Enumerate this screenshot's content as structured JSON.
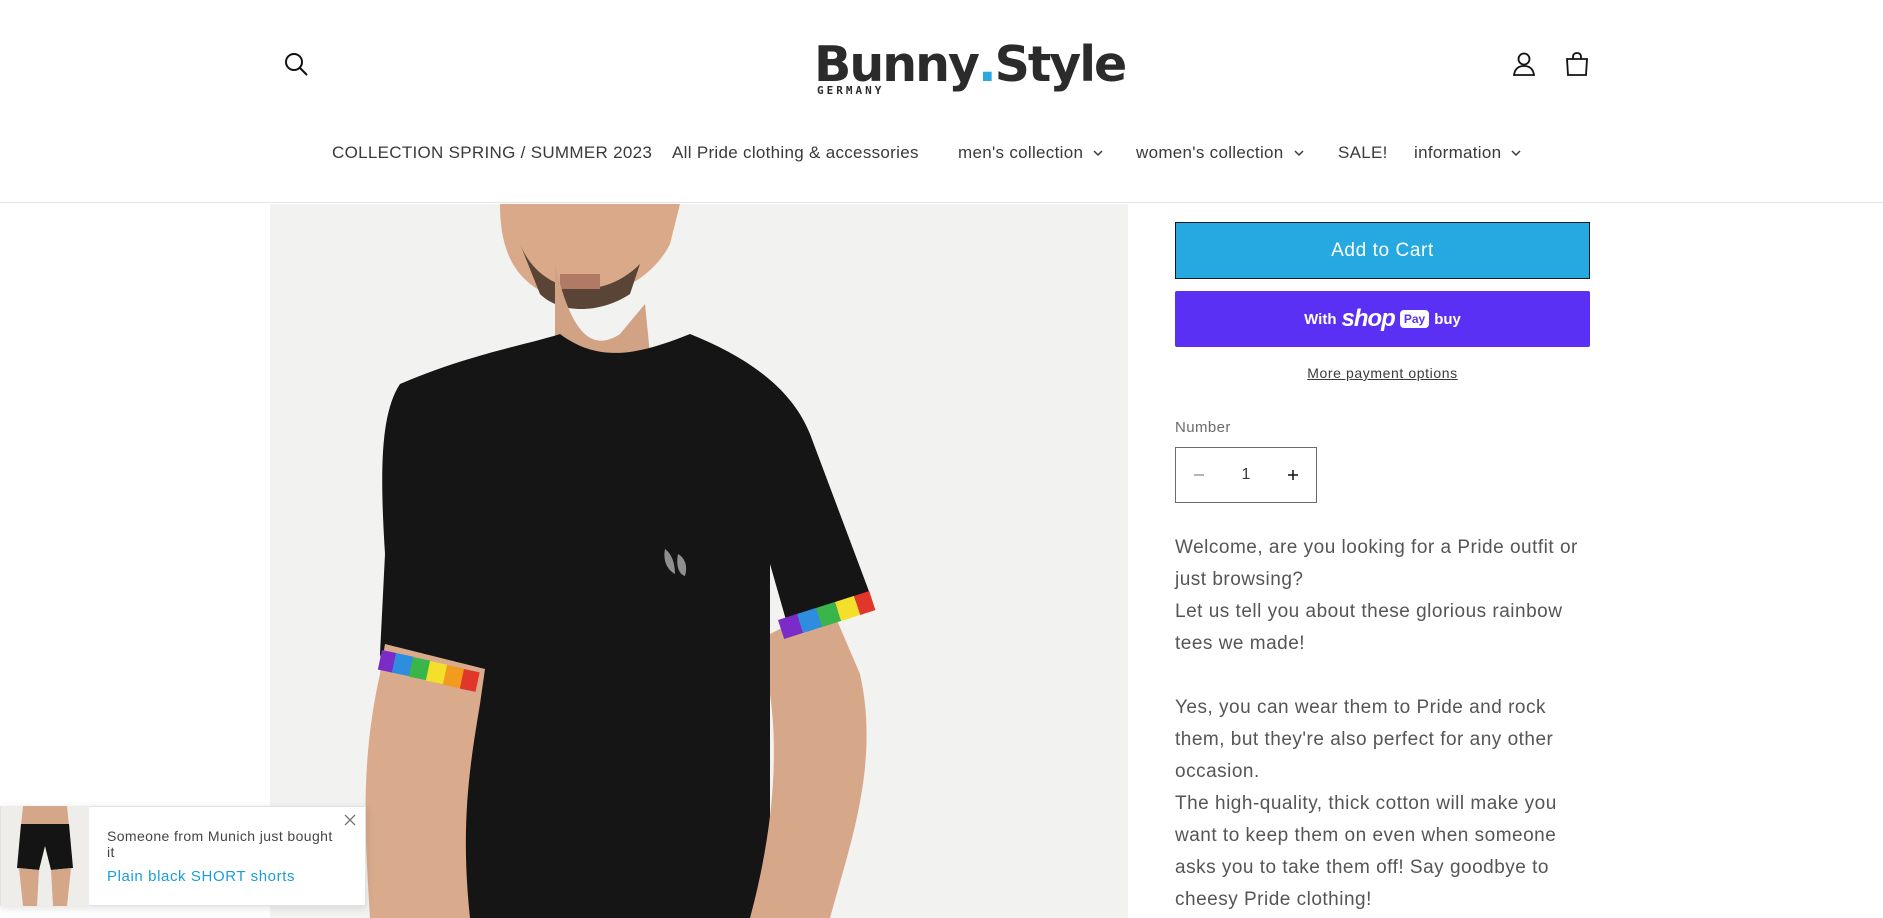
{
  "header": {
    "logo": {
      "main_part1": "Bunny",
      "dot": ".",
      "main_part2": "Style",
      "sub": "GERMANY"
    },
    "icons": {
      "search": "search-icon",
      "account": "account-icon",
      "cart": "cart-icon"
    }
  },
  "nav": {
    "items": [
      {
        "label": "COLLECTION SPRING / SUMMER 2023"
      },
      {
        "label": "All Pride clothing & accessories"
      },
      {
        "label": "men's collection"
      },
      {
        "label": "women's collection"
      },
      {
        "label": "SALE!"
      },
      {
        "label": "information"
      }
    ]
  },
  "product": {
    "add_to_cart": "Add to Cart",
    "shop_pay": {
      "with": "With",
      "shop": "shop",
      "pay": "Pay",
      "buy": "buy"
    },
    "more_payment": "More payment options",
    "quantity": {
      "label": "Number",
      "value": "1"
    },
    "description": [
      "Welcome, are you looking for a Pride outfit or just browsing?",
      "Let us tell you about these glorious rainbow tees we made!",
      "Yes, you can wear them to Pride and rock them, but they're also perfect for any other occasion.",
      "The high-quality, thick cotton will make you want to keep them on even when someone asks you to take them off! Say goodbye to cheesy Pride clothing!"
    ]
  },
  "toast": {
    "message": "Someone from Munich just bought it",
    "product_link": "Plain black SHORT shorts"
  },
  "colors": {
    "accent": "#25a9e0",
    "shop_pay": "#5a31f4",
    "link": "#1a9dd9"
  }
}
